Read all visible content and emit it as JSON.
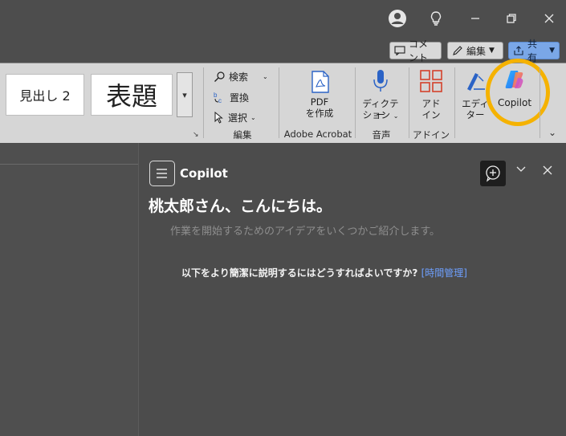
{
  "window": {
    "account_icon": "person-circle-icon",
    "lightbulb_icon": "lightbulb-icon",
    "minimize_icon": "minimize-icon",
    "restore_icon": "restore-icon",
    "close_icon": "close-icon"
  },
  "actions": {
    "comment_label": "コメント",
    "edit_label": "編集",
    "share_label": "共有"
  },
  "ribbon": {
    "styles": {
      "heading2": "見出し 2",
      "title": "表題"
    },
    "editing": {
      "find": "検索",
      "replace": "置換",
      "select": "選択",
      "group_label": "編集"
    },
    "acrobat": {
      "pdf_line1": "PDF",
      "pdf_line2": "を作成",
      "group_label": "Adobe Acrobat"
    },
    "voice": {
      "dictate_line1": "ディクテー",
      "dictate_line2": "ション",
      "group_label": "音声"
    },
    "addins": {
      "addin_line1": "アド",
      "addin_line2": "イン",
      "group_label": "アドイン"
    },
    "editor": {
      "line1": "エディ",
      "line2": "ター"
    },
    "copilot": {
      "label": "Copilot"
    }
  },
  "pane": {
    "title": "Copilot",
    "greeting": "桃太郎さん、こんにちは。",
    "subtitle": "作業を開始するためのアイデアをいくつかご紹介します。",
    "prompt_text": "以下をより簡潔に説明するにはどうすればよいですか?",
    "prompt_link": "[時間管理]"
  },
  "colors": {
    "highlight": "#f5b200",
    "link": "#6ea0ff"
  }
}
